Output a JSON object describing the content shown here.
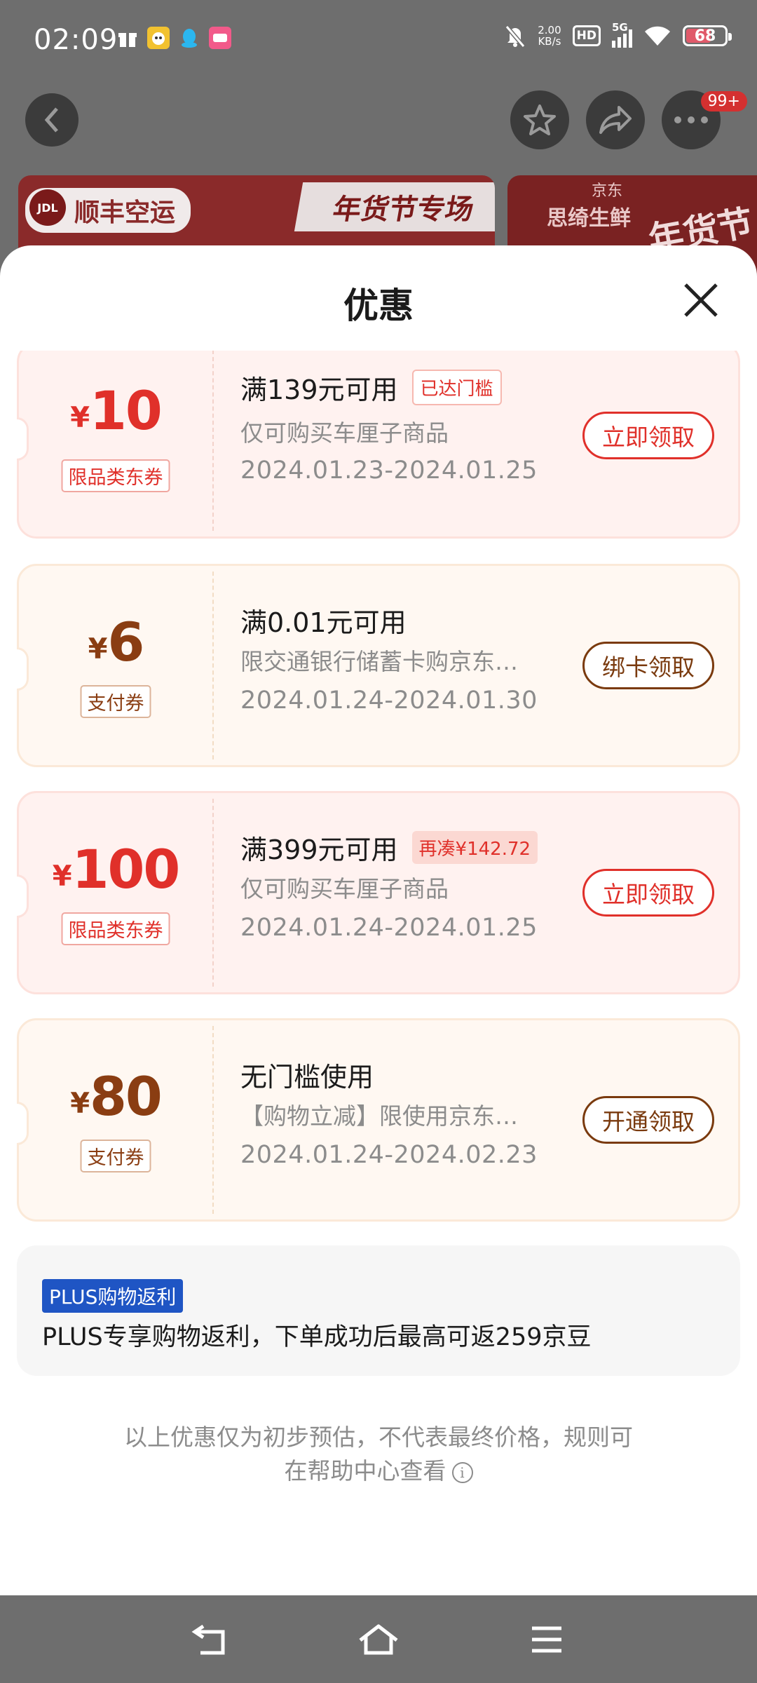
{
  "status_bar": {
    "time": "02:09",
    "net_speed_value": "2.00",
    "net_speed_unit": "KB/s",
    "hd": "HD",
    "network": "5G",
    "battery": "68",
    "battery_level_percent": 68
  },
  "background": {
    "more_badge": "99+",
    "banner_left_logo": "顺丰空运",
    "banner_left_logo_mark": "JDL",
    "banner_left_title": "年货节专场",
    "banner_right_brand": "京东",
    "banner_right_text": "思绮生鲜",
    "banner_right_fest": "年货节"
  },
  "sheet": {
    "title": "优惠",
    "coupons": [
      {
        "currency": "¥",
        "amount": "10",
        "type": "限品类东券",
        "condition": "满139元可用",
        "tag": "已达门槛",
        "desc": "仅可购买车厘子商品",
        "date": "2024.01.23-2024.01.25",
        "action": "立即领取"
      },
      {
        "currency": "¥",
        "amount": "6",
        "type": "支付券",
        "condition": "满0.01元可用",
        "tag": "",
        "desc": "限交通银行储蓄卡购京东…",
        "date": "2024.01.24-2024.01.30",
        "action": "绑卡领取"
      },
      {
        "currency": "¥",
        "amount": "100",
        "type": "限品类东券",
        "condition": "满399元可用",
        "tag": "再凑¥142.72",
        "desc": "仅可购买车厘子商品",
        "date": "2024.01.24-2024.01.25",
        "action": "立即领取"
      },
      {
        "currency": "¥",
        "amount": "80",
        "type": "支付券",
        "condition": "无门槛使用",
        "tag": "",
        "desc": "【购物立减】限使用京东…",
        "date": "2024.01.24-2024.02.23",
        "action": "开通领取"
      }
    ],
    "plus": {
      "badge": "PLUS购物返利",
      "text": "PLUS专享购物返利，下单成功后最高可返259京豆"
    },
    "footnote_line1": "以上优惠仅为初步预估，不代表最终价格，规则可",
    "footnote_line2": "在帮助中心查看"
  },
  "colors": {
    "coupon_red": "#e0302a",
    "coupon_brown": "#8a3d12",
    "plus_blue": "#1f55c4"
  },
  "icons": [
    "back-icon",
    "star-icon",
    "share-icon",
    "more-icon",
    "close-icon",
    "info-icon",
    "nav-back-icon",
    "nav-home-icon",
    "nav-menu-icon"
  ]
}
